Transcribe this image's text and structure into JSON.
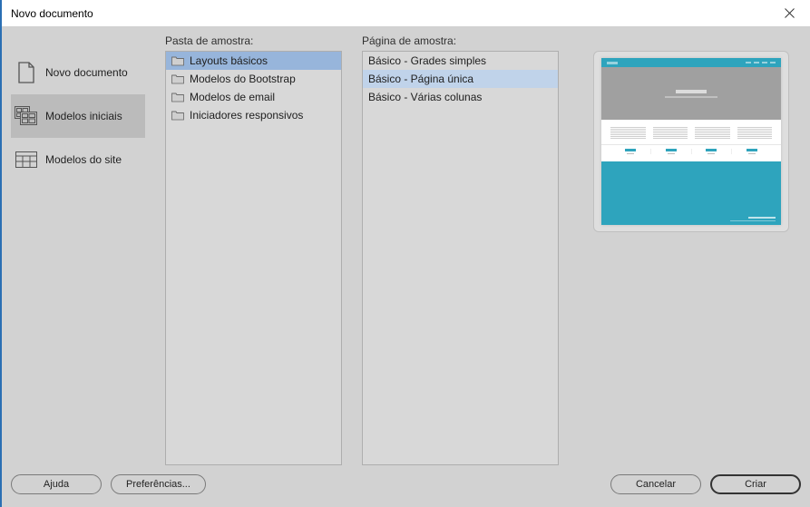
{
  "window": {
    "title": "Novo documento"
  },
  "sidebar": {
    "items": [
      {
        "label": "Novo documento",
        "selected": false,
        "icon": "file-icon"
      },
      {
        "label": "Modelos iniciais",
        "selected": true,
        "icon": "templates-grid-icon"
      },
      {
        "label": "Modelos do site",
        "selected": false,
        "icon": "site-grid-icon"
      }
    ]
  },
  "folder_column": {
    "header": "Pasta de amostra:",
    "items": [
      {
        "label": "Layouts básicos",
        "selected": true
      },
      {
        "label": "Modelos do Bootstrap",
        "selected": false
      },
      {
        "label": "Modelos de email",
        "selected": false
      },
      {
        "label": "Iniciadores responsivos",
        "selected": false
      }
    ]
  },
  "page_column": {
    "header": "Página de amostra:",
    "items": [
      {
        "label": "Básico - Grades simples",
        "selected": false
      },
      {
        "label": "Básico - Página única",
        "selected": true
      },
      {
        "label": "Básico - Várias colunas",
        "selected": false
      }
    ]
  },
  "footer": {
    "help": "Ajuda",
    "preferences": "Preferências...",
    "cancel": "Cancelar",
    "create": "Criar"
  },
  "colors": {
    "selection_dark": "#97b5db",
    "selection_light": "#c0d3ea",
    "sidebar_selected": "#bbbbbb",
    "preview_accent": "#2ea4bd"
  }
}
